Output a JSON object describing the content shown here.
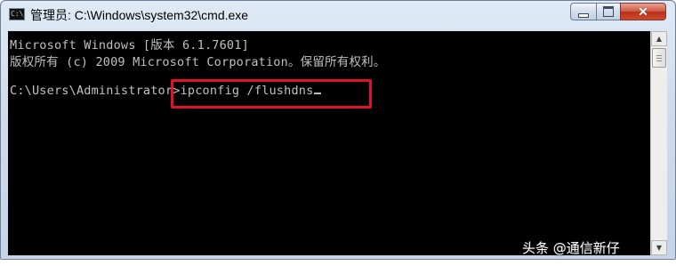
{
  "window": {
    "title": "管理员: C:\\Windows\\system32\\cmd.exe",
    "icon_text": "C:\\",
    "controls": {
      "minimize": "minimize-icon",
      "maximize": "maximize-icon",
      "close": "close-icon"
    },
    "colors": {
      "console_bg": "#000000",
      "console_fg": "#c0c0c0",
      "highlight": "#e0112a"
    }
  },
  "console": {
    "line1": "Microsoft Windows [版本 6.1.7601]",
    "line2": "版权所有 (c) 2009 Microsoft Corporation。保留所有权利。",
    "prompt": "C:\\Users\\Administrator>",
    "command": "ipconfig /flushdns"
  },
  "watermark": "头条 @通信新仔"
}
